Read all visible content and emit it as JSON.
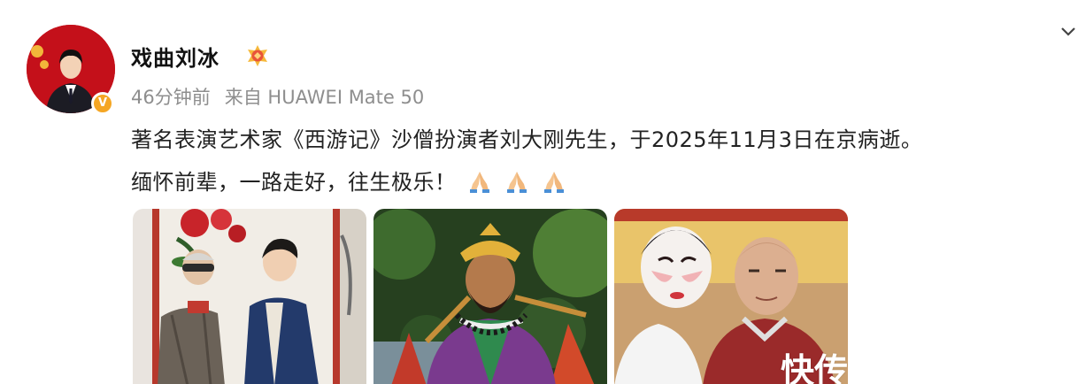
{
  "user": {
    "name": "戏曲刘冰"
  },
  "meta": {
    "time": "46分钟前",
    "source": "来自 HUAWEI Mate 50"
  },
  "post": {
    "line1": "著名表演艺术家《西游记》沙僧扮演者刘大刚先生，于2025年11月3日在京病逝。",
    "line2": "缅怀前辈，一路走好，往生极乐！"
  },
  "icons": [
    "chevron-down-icon",
    "verified-icon",
    "level-badge-icon",
    "pray-emoji-icon"
  ],
  "colors": {
    "accent": "#f5a623",
    "meta_text": "#8e8e8e",
    "avatar_bg": "#c4101a"
  },
  "watermark": "快传"
}
